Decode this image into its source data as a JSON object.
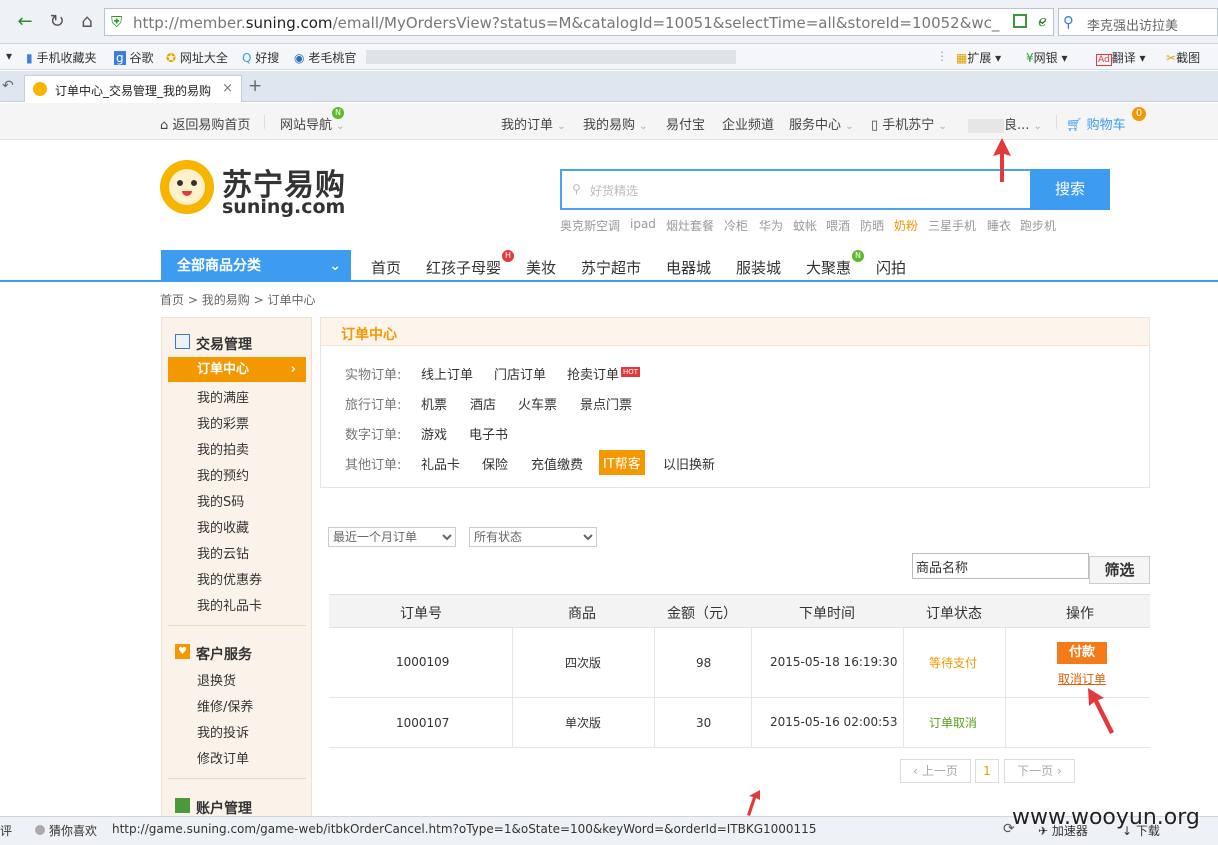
{
  "browser": {
    "url_prefix": "http://member.",
    "url_domain": "suning.com",
    "url_rest": "/emall/MyOrdersView?status=M&catalogId=10051&selectTime=all&storeId=10052&wc_",
    "search_text": "李克强出访拉美",
    "bookmarks": [
      "手机收藏夹",
      "谷歌",
      "网址大全",
      "好搜",
      "老毛桃官"
    ],
    "toolbar_right": [
      "扩展",
      "网银",
      "翻译",
      "截图"
    ],
    "tab_title": "订单中心_交易管理_我的易购",
    "status_left": [
      "评",
      "猜你喜欢"
    ],
    "status_url": "http://game.suning.com/game-web/itbkOrderCancel.htm?oType=1&oState=100&keyWord=&orderId=ITBKG1000115",
    "status_right": [
      "加速器",
      "下载"
    ],
    "watermark": "www.wooyun.org"
  },
  "topnav": {
    "home": "返回易购首页",
    "site_nav": "网站导航",
    "items": [
      "我的订单",
      "我的易购",
      "易付宝",
      "企业频道",
      "服务中心",
      "手机苏宁"
    ],
    "user": "良...",
    "cart": "购物车",
    "cart_count": "0"
  },
  "logo": {
    "cn": "苏宁易购",
    "en": "suning.com"
  },
  "search": {
    "placeholder": "好货精选",
    "button": "搜索",
    "hotwords": [
      "奥克斯空调",
      "ipad",
      "烟灶套餐",
      "冷柜",
      "华为",
      "蚊帐",
      "喂酒",
      "防晒",
      "奶粉",
      "三星手机",
      "睡衣",
      "跑步机"
    ]
  },
  "catnav": {
    "all": "全部商品分类",
    "items": [
      "首页",
      "红孩子母婴",
      "美妆",
      "苏宁超市",
      "电器城",
      "服装城",
      "大聚惠",
      "闪拍"
    ],
    "badge_h": "H",
    "badge_n": "N"
  },
  "breadcrumb": {
    "a": "首页",
    "b": "我的易购",
    "c": "订单中心",
    "sep": ">"
  },
  "sidebar": {
    "trade": "交易管理",
    "active": "订单中心",
    "trade_items": [
      "我的满座",
      "我的彩票",
      "我的拍卖",
      "我的预约",
      "我的S码",
      "我的收藏",
      "我的云钻",
      "我的优惠券",
      "我的礼品卡"
    ],
    "service": "客户服务",
    "service_items": [
      "退换货",
      "维修/保养",
      "我的投诉",
      "修改订单"
    ],
    "account": "账户管理"
  },
  "panel": {
    "title": "订单中心",
    "rows": [
      {
        "label": "实物订单:",
        "items": [
          "线上订单",
          "门店订单",
          "抢卖订单"
        ]
      },
      {
        "label": "旅行订单:",
        "items": [
          "机票",
          "酒店",
          "火车票",
          "景点门票"
        ]
      },
      {
        "label": "数字订单:",
        "items": [
          "游戏",
          "电子书"
        ]
      },
      {
        "label": "其他订单:",
        "items": [
          "礼品卡",
          "保险",
          "充值缴费",
          "IT帮客",
          "以旧换新"
        ]
      }
    ],
    "hot": "HOT"
  },
  "filters": {
    "time": "最近一个月订单",
    "status": "所有状态",
    "keyword": "商品名称",
    "button": "筛选"
  },
  "table": {
    "headers": [
      "订单号",
      "商品",
      "金额（元）",
      "下单时间",
      "订单状态",
      "操作"
    ],
    "rows": [
      {
        "id": "1000109",
        "product": "四次版",
        "amount": "98",
        "time": "2015-05-18 16:19:30",
        "status": "等待支付",
        "pay": "付款",
        "cancel": "取消订单"
      },
      {
        "id": "1000107",
        "product": "单次版",
        "amount": "30",
        "time": "2015-05-16 02:00:53",
        "status": "订单取消"
      }
    ]
  },
  "pager": {
    "prev": "上一页",
    "page": "1",
    "next": "下一页"
  },
  "colors": {
    "orange": "#f39800",
    "blue": "#3d9bf0",
    "red": "#e4393c",
    "green": "#5a9e1f"
  }
}
